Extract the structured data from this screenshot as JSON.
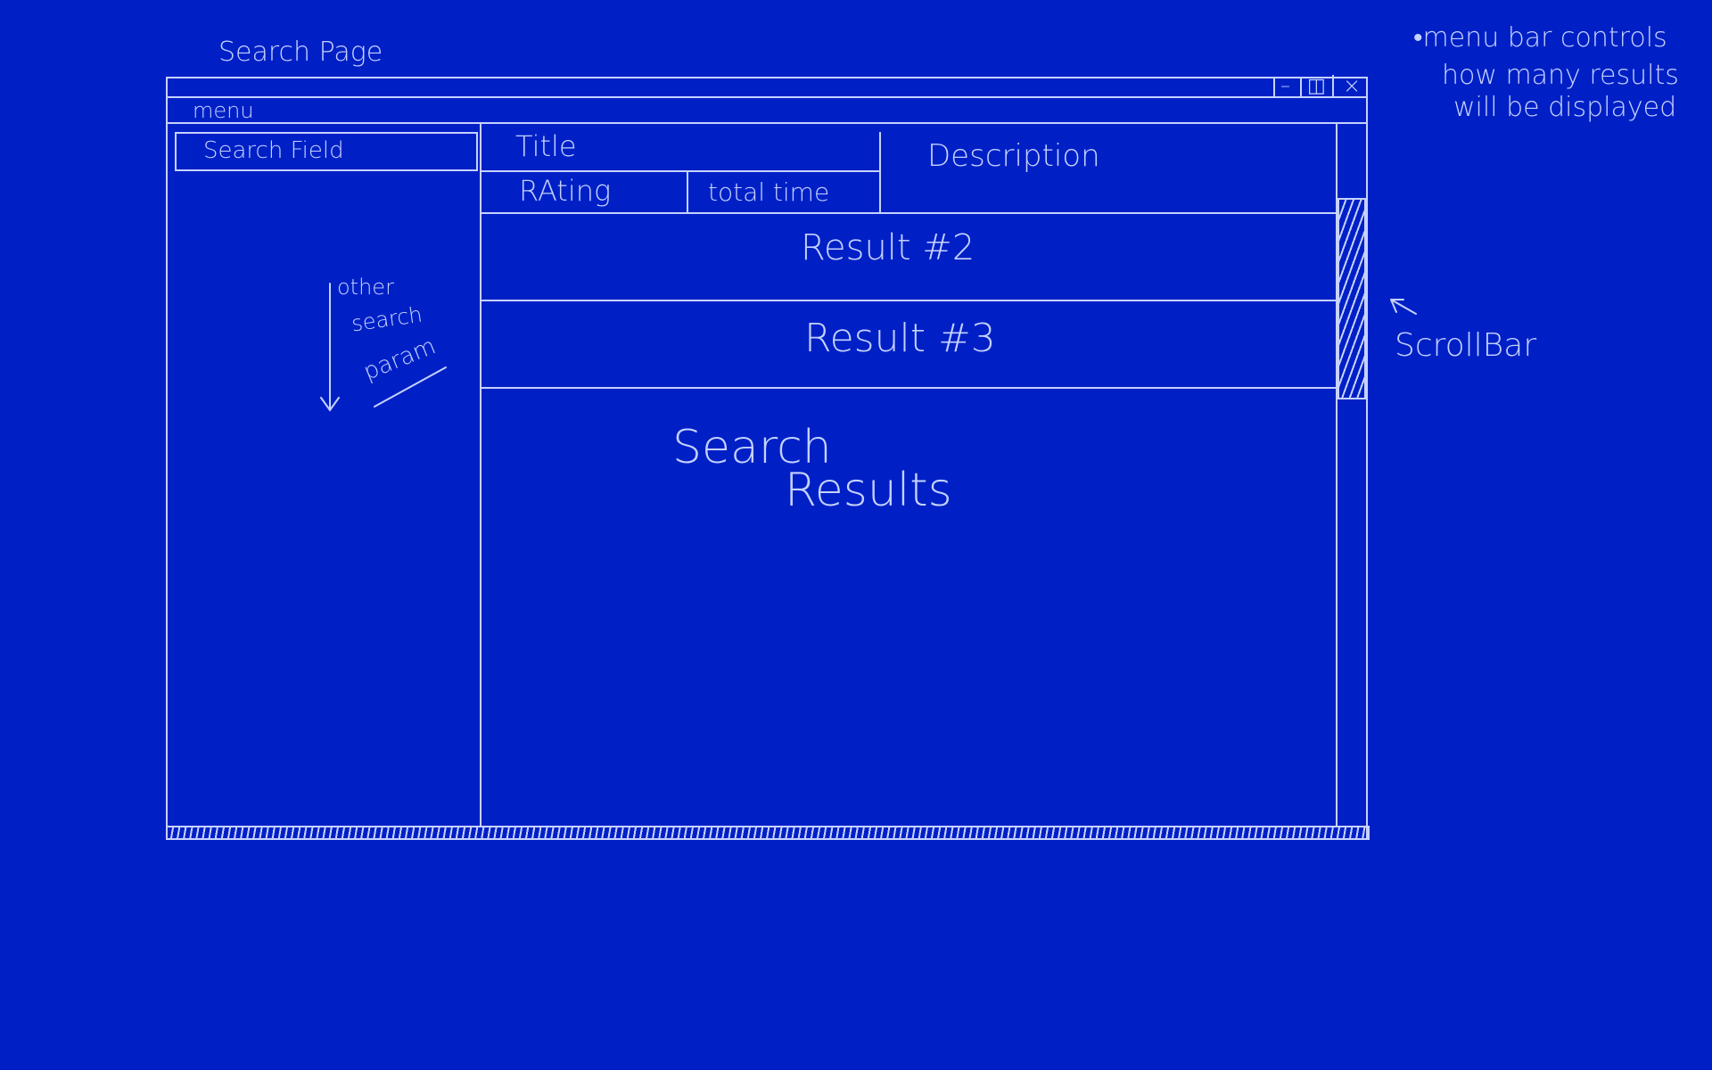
{
  "page_title": "Search Page",
  "window": {
    "menu_label": "menu",
    "controls": {
      "minimize": "–",
      "maximize": "◫",
      "close": "×"
    }
  },
  "sidebar": {
    "search_field": "Search Field",
    "note_lines": [
      "other",
      "search",
      "param"
    ]
  },
  "result_header": {
    "title": "Title",
    "rating": "RAting",
    "total_time": "total time",
    "description": "Description"
  },
  "results": [
    "Result #2",
    "Result #3"
  ],
  "results_area_label_line1": "Search",
  "results_area_label_line2": "Results",
  "annotations": {
    "menu_note": [
      "•menu bar controls",
      "how many results",
      "will be displayed"
    ],
    "scrollbar_note": "ScrollBar"
  },
  "colors": {
    "background": "#0020c6",
    "ink": "#c6d2ff"
  }
}
